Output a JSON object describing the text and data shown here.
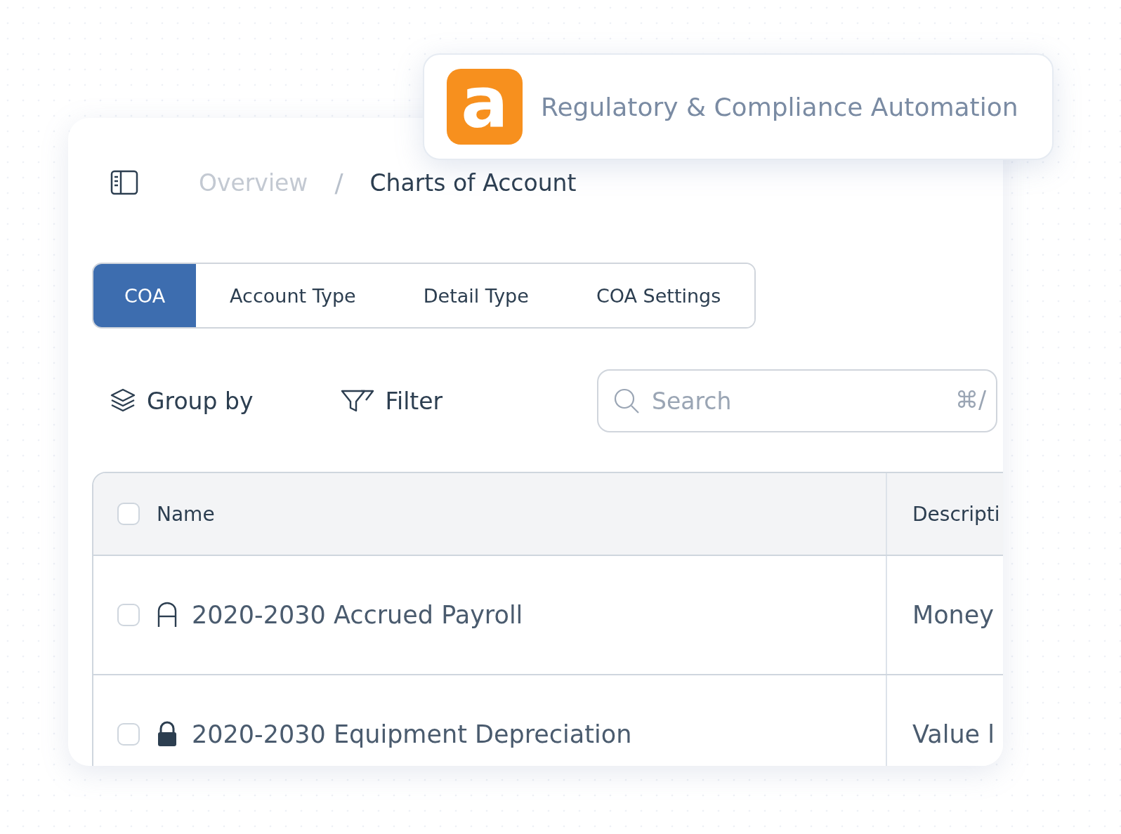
{
  "popup": {
    "logo_letter": "a",
    "title": "Regulatory & Compliance Automation"
  },
  "breadcrumb": [
    {
      "label": "Overview",
      "current": false
    },
    {
      "label": "Charts of Account",
      "current": true
    }
  ],
  "breadcrumb_separator": "/",
  "tabs": [
    {
      "label": "COA",
      "selected": true
    },
    {
      "label": "Account Type",
      "selected": false
    },
    {
      "label": "Detail Type",
      "selected": false
    },
    {
      "label": "COA Settings",
      "selected": false
    }
  ],
  "toolbar": {
    "group_by": "Group by",
    "filter": "Filter"
  },
  "search": {
    "placeholder": "Search",
    "shortcut": "⌘/"
  },
  "table": {
    "columns": [
      "Name",
      "Descripti"
    ],
    "header_checked": false,
    "rows": [
      {
        "checked": false,
        "locked": false,
        "name": "2020-2030 Accrued Payroll",
        "description": "Money"
      },
      {
        "checked": false,
        "locked": true,
        "name": "2020-2030 Equipment Depreciation",
        "description": "Value l"
      }
    ]
  }
}
